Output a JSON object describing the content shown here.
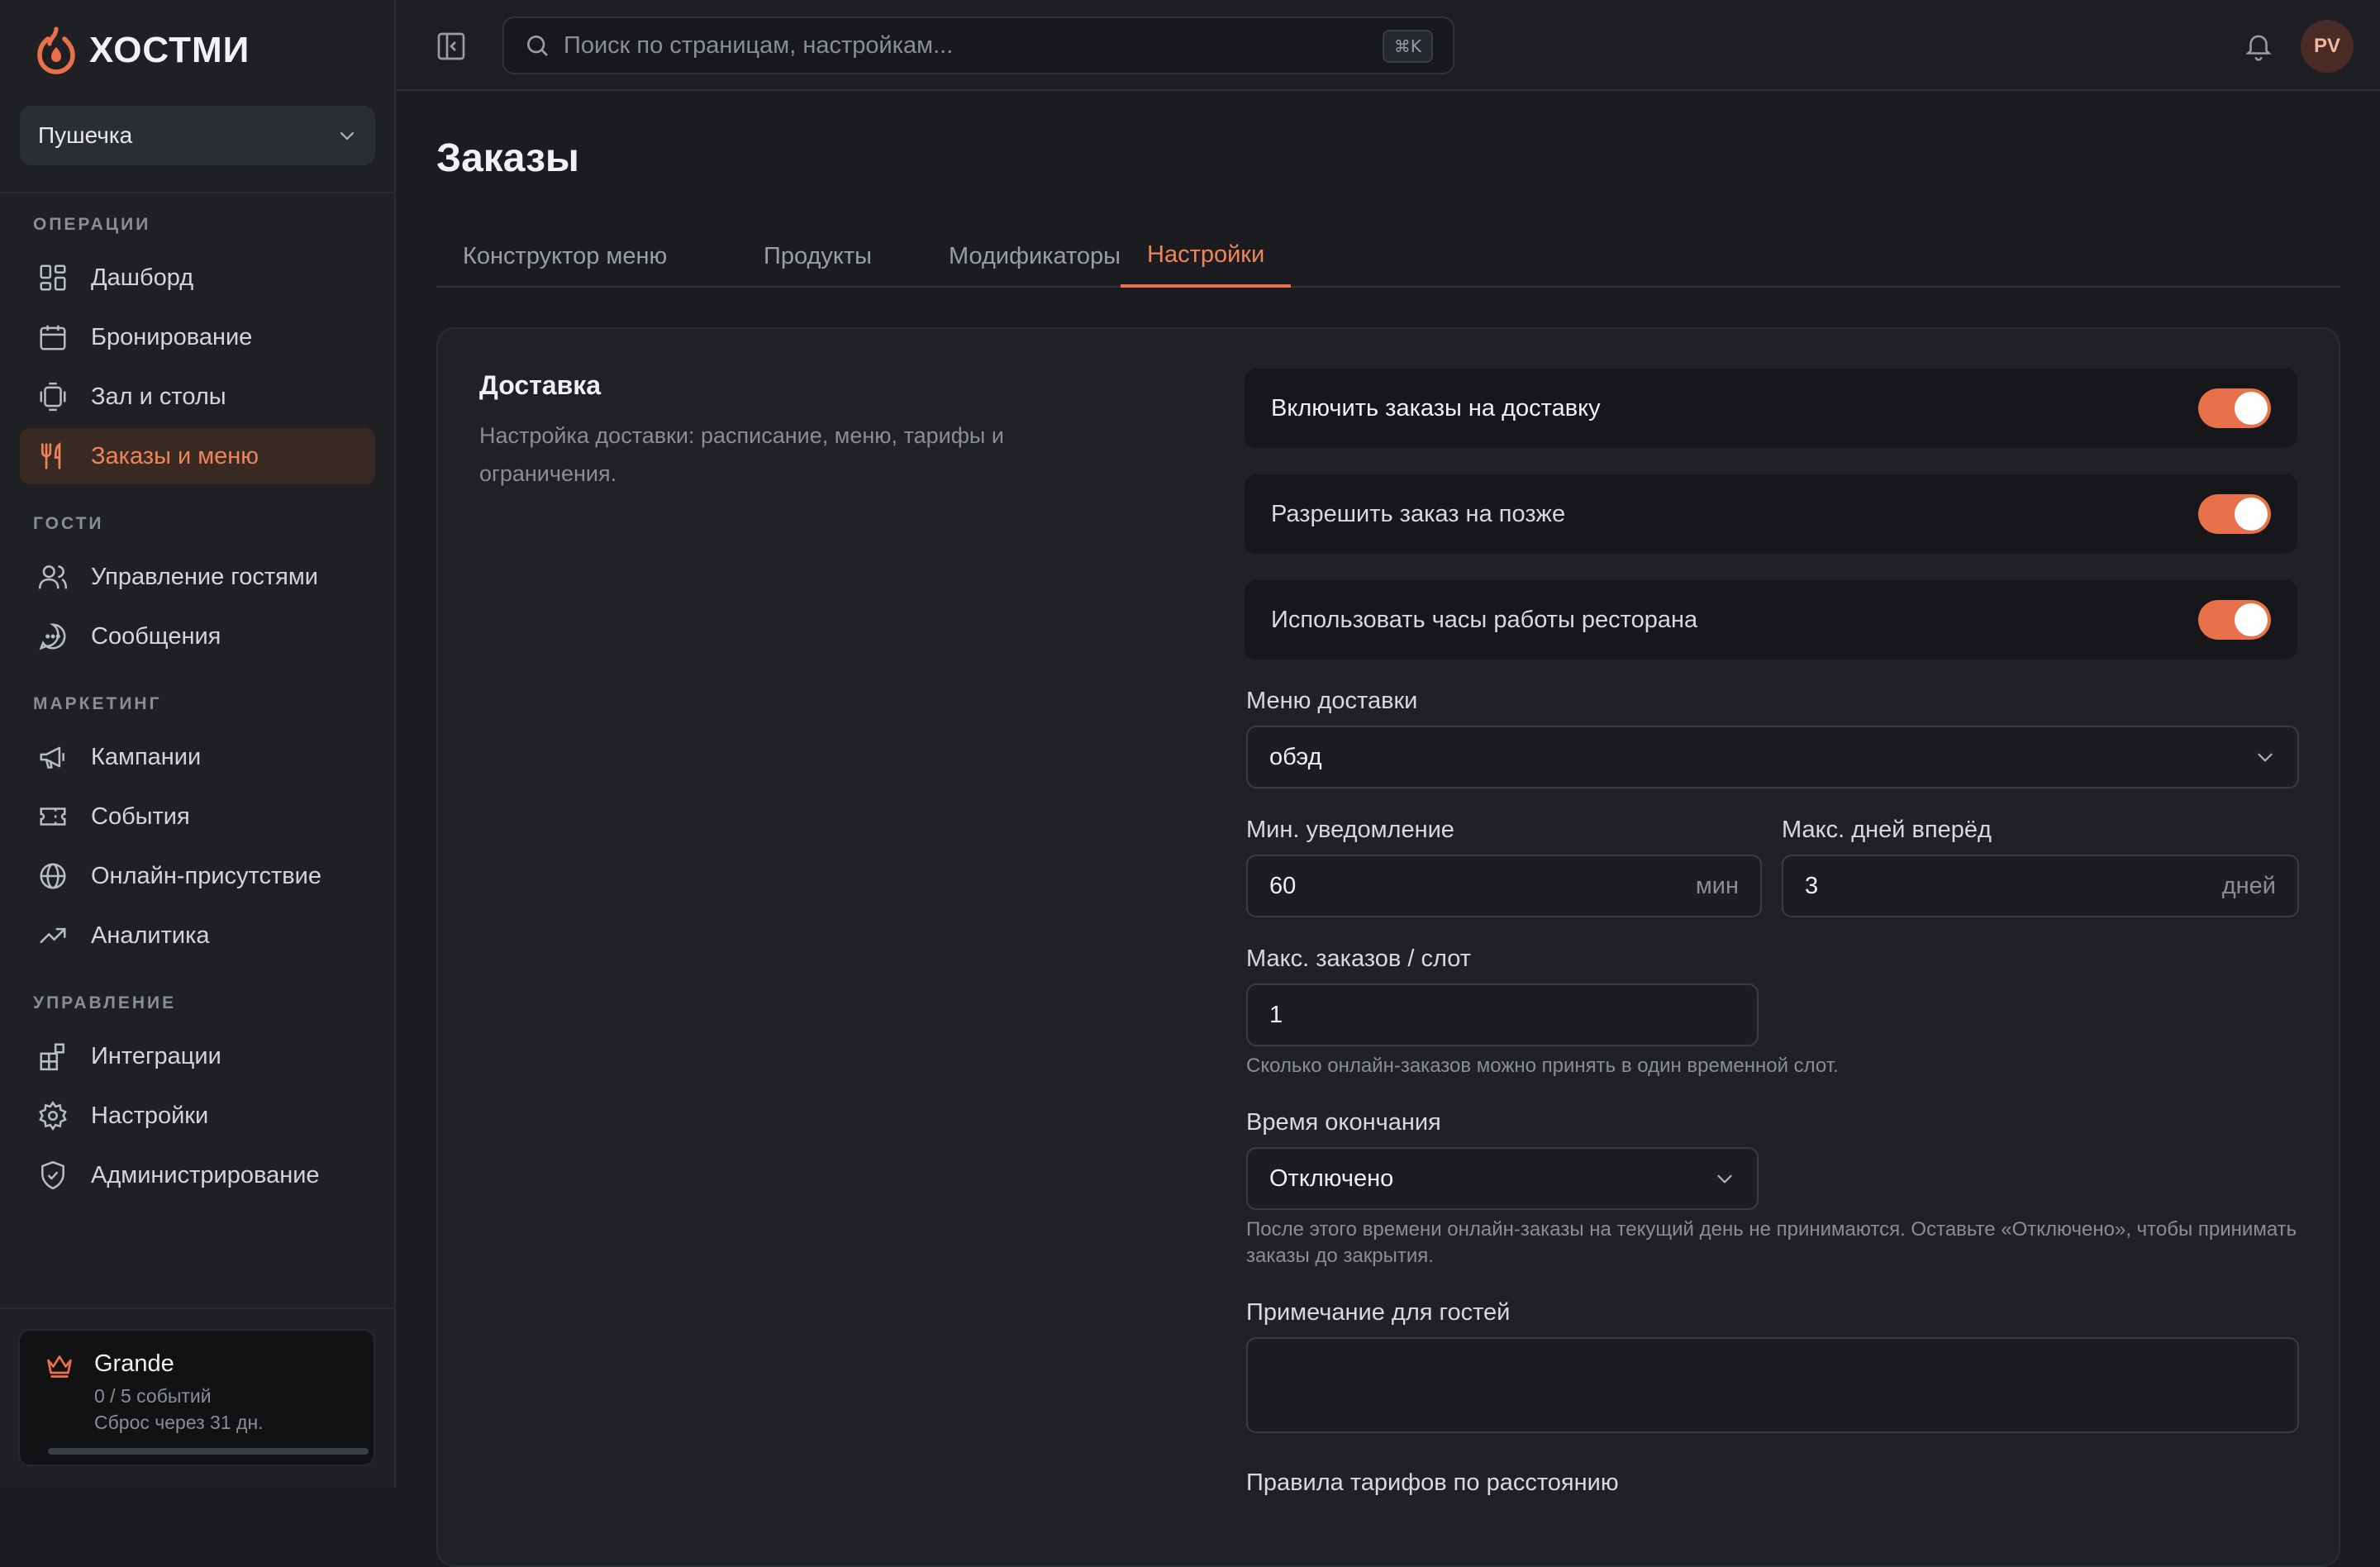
{
  "brand": {
    "name": "ХОСТМИ",
    "accent": "#e8704a"
  },
  "venue": {
    "name": "Пушечка"
  },
  "sidebar": {
    "sections": [
      {
        "label": "ОПЕРАЦИИ"
      },
      {
        "label": "ГОСТИ"
      },
      {
        "label": "МАРКЕТИНГ"
      },
      {
        "label": "УПРАВЛЕНИЕ"
      }
    ],
    "items": [
      {
        "label": "Дашборд",
        "icon": "dashboard-icon"
      },
      {
        "label": "Бронирование",
        "icon": "calendar-icon"
      },
      {
        "label": "Зал и столы",
        "icon": "table-icon"
      },
      {
        "label": "Заказы и меню",
        "icon": "utensils-icon",
        "active": true
      },
      {
        "label": "Управление гостями",
        "icon": "users-icon"
      },
      {
        "label": "Сообщения",
        "icon": "chat-icon"
      },
      {
        "label": "Кампании",
        "icon": "megaphone-icon"
      },
      {
        "label": "События",
        "icon": "ticket-icon"
      },
      {
        "label": "Онлайн-присутствие",
        "icon": "globe-icon"
      },
      {
        "label": "Аналитика",
        "icon": "trend-icon"
      },
      {
        "label": "Интеграции",
        "icon": "blocks-icon"
      },
      {
        "label": "Настройки",
        "icon": "gear-icon"
      },
      {
        "label": "Администрирование",
        "icon": "shield-icon"
      }
    ],
    "plan": {
      "name": "Grande",
      "usage": "0 / 5 событий",
      "reset": "Сброс через 31 дн.",
      "progress": 0
    }
  },
  "topbar": {
    "search_placeholder": "Поиск по страницам, настройкам...",
    "shortcut": "⌘K",
    "avatar_initials": "PV"
  },
  "page": {
    "title": "Заказы",
    "tabs": [
      {
        "label": "Конструктор меню"
      },
      {
        "label": "Продукты"
      },
      {
        "label": "Модификаторы"
      },
      {
        "label": "Настройки",
        "active": true
      }
    ]
  },
  "delivery": {
    "title": "Доставка",
    "description": "Настройка доставки: расписание, меню, тарифы и ограничения.",
    "toggles": [
      {
        "label": "Включить заказы на доставку",
        "on": true
      },
      {
        "label": "Разрешить заказ на позже",
        "on": true
      },
      {
        "label": "Использовать часы работы ресторана",
        "on": true
      }
    ],
    "menu": {
      "label": "Меню доставки",
      "value": "обэд"
    },
    "min_notice": {
      "label": "Мин. уведомление",
      "value": "60",
      "suffix": "мин"
    },
    "max_days": {
      "label": "Макс. дней вперёд",
      "value": "3",
      "suffix": "дней"
    },
    "max_orders": {
      "label": "Макс. заказов / слот",
      "value": "1",
      "hint": "Сколько онлайн-заказов можно принять в один временной слот."
    },
    "cutoff": {
      "label": "Время окончания",
      "value": "Отключено",
      "hint": "После этого времени онлайн-заказы на текущий день не принимаются. Оставьте «Отключено», чтобы принимать заказы до закрытия."
    },
    "guest_note": {
      "label": "Примечание для гостей",
      "value": ""
    },
    "distance_rules": {
      "label": "Правила тарифов по расстоянию"
    }
  }
}
